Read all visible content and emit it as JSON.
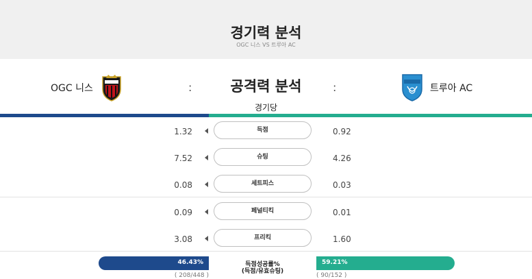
{
  "header": {
    "title": "경기력 분석",
    "subtitle": "OGC 니스 VS 트루아 AC"
  },
  "teams": {
    "home": {
      "name": "OGC 니스",
      "color": "#1e4a8c",
      "logo_icon": "ogc-nice-crest-icon"
    },
    "away": {
      "name": "트루아 AC",
      "color": "#24ad8f",
      "logo_icon": "troyes-ac-crest-icon"
    },
    "separator": ":"
  },
  "section": {
    "title": "공격력 분석",
    "subtitle": "경기당"
  },
  "stats": [
    {
      "label": "득점",
      "home": "1.32",
      "away": "0.92"
    },
    {
      "label": "슈팅",
      "home": "7.52",
      "away": "4.26"
    },
    {
      "label": "세트피스",
      "home": "0.08",
      "away": "0.03"
    },
    {
      "label": "페널티킥",
      "home": "0.09",
      "away": "0.01"
    },
    {
      "label": "프리킥",
      "home": "3.08",
      "away": "1.60"
    }
  ],
  "footer": {
    "label_line1": "득점성공률%",
    "label_line2": "(득점/유효슈팅)",
    "home_pct": "46.43%",
    "away_pct": "59.21%",
    "home_count": "( 208/448 )",
    "away_count": "( 90/152 )"
  }
}
